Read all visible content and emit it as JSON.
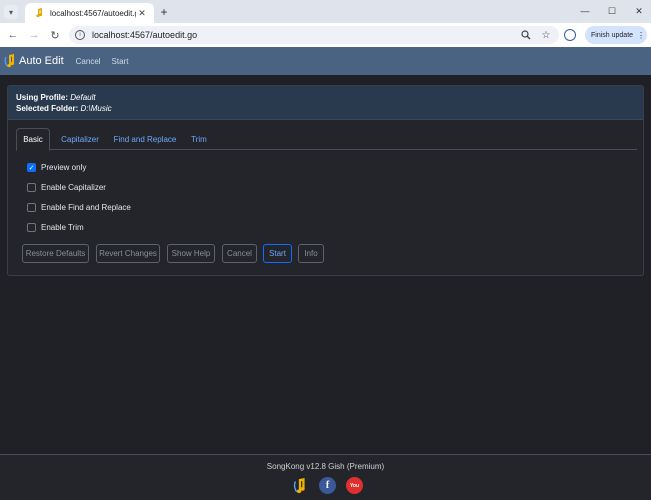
{
  "browser": {
    "tab_title": "localhost:4567/autoedit.go",
    "url": "localhost:4567/autoedit.go",
    "finish_update_label": "Finish update",
    "new_tab_symbol": "+"
  },
  "navbar": {
    "brand": "Auto Edit",
    "links": [
      "Cancel",
      "Start"
    ]
  },
  "header": {
    "profile_label": "Using Profile:",
    "profile_value": "Default",
    "folder_label": "Selected Folder:",
    "folder_value": "D:\\Music"
  },
  "tabs": [
    "Basic",
    "Capitalizer",
    "Find and Replace",
    "Trim"
  ],
  "options": [
    {
      "label": "Preview only",
      "checked": true
    },
    {
      "label": "Enable Capitalizer",
      "checked": false
    },
    {
      "label": "Enable Find and Replace",
      "checked": false
    },
    {
      "label": "Enable Trim",
      "checked": false
    }
  ],
  "buttons": [
    "Restore Defaults",
    "Revert Changes",
    "Show Help",
    "Cancel",
    "Start",
    "Info"
  ],
  "footer": {
    "version": "SongKong v12.8 Gish (Premium)",
    "icons": [
      "songkong-logo-icon",
      "facebook-icon",
      "youtube-icon"
    ]
  },
  "colors": {
    "navbar": "#4a6383",
    "accent": "#0d6efd",
    "background": "#1f2126"
  }
}
